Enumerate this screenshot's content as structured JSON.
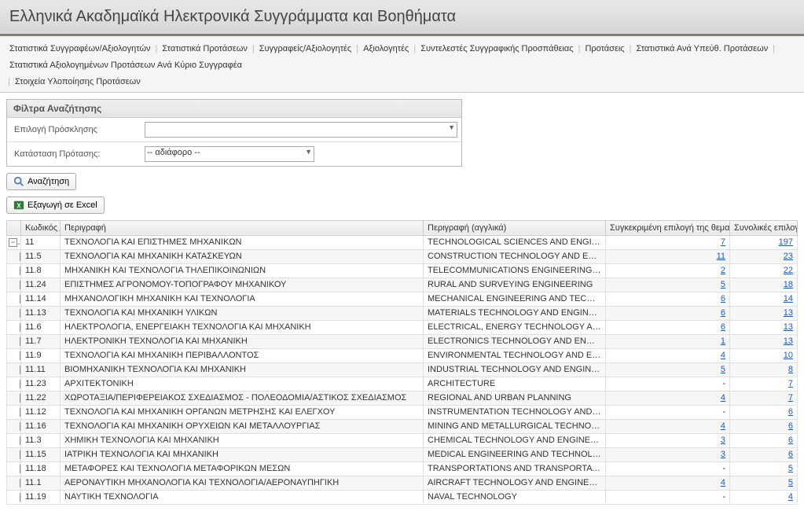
{
  "header": {
    "title": "Ελληνικά Ακαδημαϊκά Ηλεκτρονικά Συγγράμματα και Βοηθήματα"
  },
  "nav": {
    "items": [
      "Στατιστικά Συγγραφέων/Αξιολογητών",
      "Στατιστικά Προτάσεων",
      "Συγγραφείς/Αξιολογητές",
      "Αξιολογητές",
      "Συντελεστές Συγγραφικής Προσπάθειας",
      "Προτάσεις",
      "Στατιστικά Ανά Υπεύθ. Προτάσεων",
      "Στατιστικά Αξιολογημένων Προτάσεων Ανά Κύριο Συγγραφέα",
      "Στοιχεία Υλοποίησης Προτάσεων"
    ]
  },
  "filter": {
    "title": "Φίλτρα Αναζήτησης",
    "call_label": "Επιλογή Πρόσκλησης",
    "status_label": "Κατάσταση Πρότασης:",
    "status_value": "-- αδιάφορο --"
  },
  "buttons": {
    "search": "Αναζήτηση",
    "export": "Εξαγωγή σε Excel"
  },
  "columns": {
    "code": "Κωδικός",
    "desc": "Περιγραφή",
    "desce": "Περιγραφή (αγγλικά)",
    "sel": "Συγκεκριμένη επιλογή της θεματικής",
    "tot": "Συνολικές επιλογές"
  },
  "rows": [
    {
      "exp": "minus",
      "code": "11",
      "desc": "ΤΕΧΝΟΛΟΓΙΑ ΚΑΙ ΕΠΙΣΤΗΜΕΣ ΜΗΧΑΝΙΚΩΝ",
      "desce": "TECHNOLOGICAL SCIENCES AND ENGINEERING",
      "sel": "7",
      "tot": "197"
    },
    {
      "exp": "plus",
      "code": "11.5",
      "desc": "ΤΕΧΝΟΛΟΓΙΑ ΚΑΙ ΜΗΧΑΝΙΚΗ ΚΑΤΑΣΚΕΥΩΝ",
      "desce": "CONSTRUCTION TECHNOLOGY AND ENGINEERING",
      "sel": "11",
      "tot": "23"
    },
    {
      "exp": "plus",
      "code": "11.8",
      "desc": "ΜΗΧΑΝΙΚΗ ΚΑΙ ΤΕΧΝΟΛΟΓΙΑ ΤΗΛΕΠΙΚΟΙΝΩΝΙΩΝ",
      "desce": "TELECOMMUNICATIONS ENGINEERING AND TECHNOLOGY",
      "sel": "2",
      "tot": "22"
    },
    {
      "exp": "plus",
      "code": "11.24",
      "desc": "ΕΠΙΣΤΗΜΕΣ ΑΓΡΟΝΟΜΟΥ-ΤΟΠΟΓΡΑΦΟΥ ΜΗΧΑΝΙΚΟΥ",
      "desce": "RURAL AND SURVEYING ENGINEERING",
      "sel": "5",
      "tot": "18"
    },
    {
      "exp": "plus",
      "code": "11.14",
      "desc": "ΜΗΧΑΝΟΛΟΓΙΚΗ ΜΗΧΑΝΙΚΗ ΚΑΙ ΤΕΧΝΟΛΟΓΙΑ",
      "desce": "MECHANICAL ENGINEERING AND TECHNOLOGY",
      "sel": "6",
      "tot": "14"
    },
    {
      "exp": "plus",
      "code": "11.13",
      "desc": "ΤΕΧΝΟΛΟΓΙΑ ΚΑΙ ΜΗΧΑΝΙΚΗ ΥΛΙΚΩΝ",
      "desce": "MATERIALS TECHNOLOGY AND ENGINEERING",
      "sel": "6",
      "tot": "13"
    },
    {
      "exp": "plus",
      "code": "11.6",
      "desc": "ΗΛΕΚΤΡΟΛΟΓΙΑ, ΕΝΕΡΓΕΙΑΚΗ ΤΕΧΝΟΛΟΓΙΑ ΚΑΙ ΜΗΧΑΝΙΚΗ",
      "desce": "ELECTRICAL, ENERGY TECHNOLOGY AND ENGINEERING",
      "sel": "6",
      "tot": "13"
    },
    {
      "exp": "plus",
      "code": "11.7",
      "desc": "ΗΛΕΚΤΡΟΝΙΚΗ ΤΕΧΝΟΛΟΓΙΑ ΚΑΙ ΜΗΧΑΝΙΚΗ",
      "desce": "ELECTRONICS TECHNOLOGY AND ENGINEERING",
      "sel": "1",
      "tot": "13"
    },
    {
      "exp": "plus",
      "code": "11.9",
      "desc": "ΤΕΧΝΟΛΟΓΙΑ ΚΑΙ ΜΗΧΑΝΙΚΗ ΠΕΡΙΒΑΛΛΟΝΤΟΣ",
      "desce": "ENVIRONMENTAL TECHNOLOGY AND ENGINEERING",
      "sel": "4",
      "tot": "10"
    },
    {
      "exp": "plus",
      "code": "11.11",
      "desc": "ΒΙΟΜΗΧΑΝΙΚΗ ΤΕΧΝΟΛΟΓΙΑ ΚΑΙ ΜΗΧΑΝΙΚΗ",
      "desce": "INDUSTRIAL TECHNOLOGY AND ENGINEERING",
      "sel": "5",
      "tot": "8"
    },
    {
      "exp": "plus",
      "code": "11.23",
      "desc": "ΑΡΧΙΤΕΚΤΟΝΙΚΗ",
      "desce": "ARCHITECTURE",
      "sel": "-",
      "tot": "7"
    },
    {
      "exp": "plus",
      "code": "11.22",
      "desc": "ΧΩΡΟΤΑΞΙΑ/ΠΕΡΙΦΕΡΕΙΑΚΟΣ ΣΧΕΔΙΑΣΜΟΣ - ΠΟΛΕΟΔΟΜΙΑ/ΑΣΤΙΚΟΣ ΣΧΕΔΙΑΣΜΟΣ",
      "desce": "REGIONAL AND URBAN PLANNING",
      "sel": "4",
      "tot": "7"
    },
    {
      "exp": "plus",
      "code": "11.12",
      "desc": "ΤΕΧΝΟΛΟΓΙΑ ΚΑΙ ΜΗΧΑΝΙΚΗ ΟΡΓΑΝΩΝ ΜΕΤΡΗΣΗΣ ΚΑΙ ΕΛΕΓΧΟΥ",
      "desce": "INSTRUMENTATION TECHNOLOGY AND ENGINEERING",
      "sel": "-",
      "tot": "6"
    },
    {
      "exp": "plus",
      "code": "11.16",
      "desc": "ΤΕΧΝΟΛΟΓΙΑ ΚΑΙ ΜΗΧΑΝΙΚΗ ΟΡΥΧΕΙΩΝ ΚΑΙ ΜΕΤΑΛΛΟΥΡΓΙΑΣ",
      "desce": "MINING AND METALLURGICAL TECHNOLOGY AND ENGINEERING",
      "sel": "4",
      "tot": "6"
    },
    {
      "exp": "plus",
      "code": "11.3",
      "desc": "ΧΗΜΙΚΗ ΤΕΧΝΟΛΟΓΙΑ ΚΑΙ ΜΗΧΑΝΙΚΗ",
      "desce": "CHEMICAL TECHNOLOGY AND ENGINEERING",
      "sel": "3",
      "tot": "6"
    },
    {
      "exp": "plus",
      "code": "11.15",
      "desc": "ΙΑΤΡΙΚΗ ΤΕΧΝΟΛΟΓΙΑ ΚΑΙ ΜΗΧΑΝΙΚΗ",
      "desce": "MEDICAL ENGINEERING AND TECHNOLOGY",
      "sel": "3",
      "tot": "6"
    },
    {
      "exp": "plus",
      "code": "11.18",
      "desc": "ΜΕΤΑΦΟΡΕΣ ΚΑΙ ΤΕΧΝΟΛΟΓΙΑ ΜΕΤΑΦΟΡΙΚΩΝ ΜΕΣΩΝ",
      "desce": "TRANSPORTATIONS AND TRANSPORTATION SYSTEMS TECHNOLOGY",
      "sel": "-",
      "tot": "5"
    },
    {
      "exp": "plus",
      "code": "11.1",
      "desc": "ΑΕΡΟΝΑΥΤΙΚΗ ΜΗΧΑΝΟΛΟΓΙΑ ΚΑΙ ΤΕΧΝΟΛΟΓΙΑ/ΑΕΡΟΝΑΥΠΗΓΙΚΗ",
      "desce": "AIRCRAFT TECHNOLOGY AND ENGINEERING",
      "sel": "4",
      "tot": "5"
    },
    {
      "exp": "plus",
      "code": "11.19",
      "desc": "ΝΑΥΤΙΚΗ ΤΕΧΝΟΛΟΓΙΑ",
      "desce": "NAVAL TECHNOLOGY",
      "sel": "-",
      "tot": "4"
    }
  ]
}
